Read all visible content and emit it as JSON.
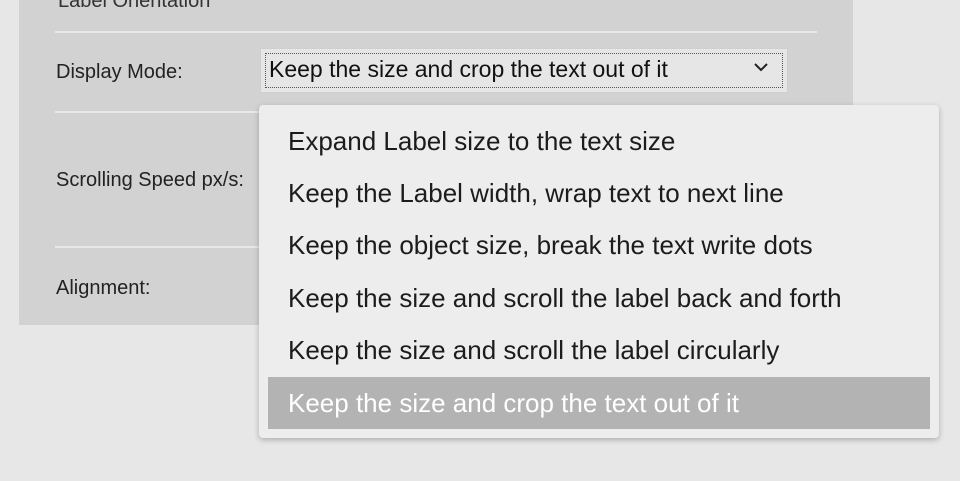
{
  "form": {
    "cut_off_label": "Label Orientation",
    "display_mode_label": "Display Mode:",
    "display_mode_value": "Keep the size and crop the text out of it",
    "scrolling_speed_label": "Scrolling Speed px/s:",
    "alignment_label": "Alignment:"
  },
  "dropdown": {
    "options": [
      "Expand Label size to the text size",
      "Keep the Label width, wrap text to next line",
      "Keep the object size, break the text write dots",
      "Keep the size and scroll the label back and forth",
      "Keep the size and scroll the label circularly",
      "Keep the size and crop the text out of it"
    ],
    "selected_option": "Keep the size and crop the text out of it"
  },
  "colors": {
    "page_background": "#e7e7e7",
    "panel_background": "#d2d2d2",
    "dropdown_background": "#ededed",
    "selected_highlight": "#b3b3b3"
  },
  "icons": {
    "dropdown_toggle": "chevron-down-icon"
  }
}
